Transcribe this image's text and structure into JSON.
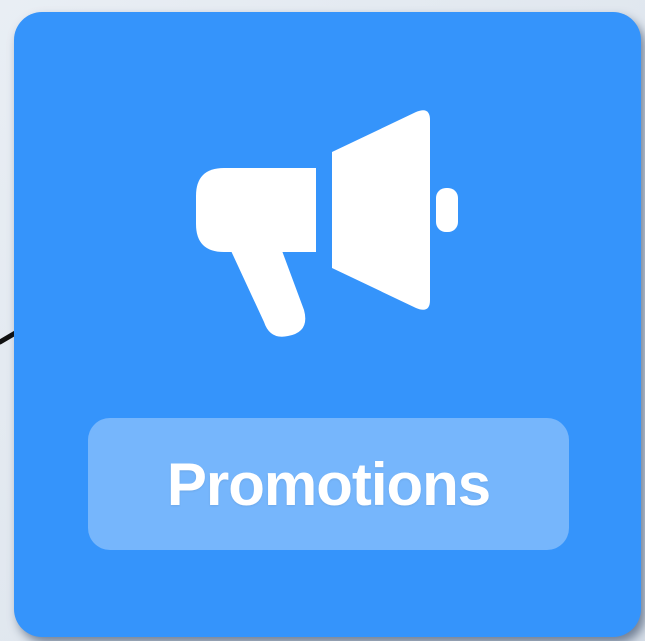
{
  "tile": {
    "label": "Promotions",
    "icon": "megaphone-icon",
    "colors": {
      "tile_background": "#3594fb",
      "label_pill": "rgba(255,255,255,0.32)",
      "text": "#ffffff",
      "connector_line": "#111111"
    }
  }
}
